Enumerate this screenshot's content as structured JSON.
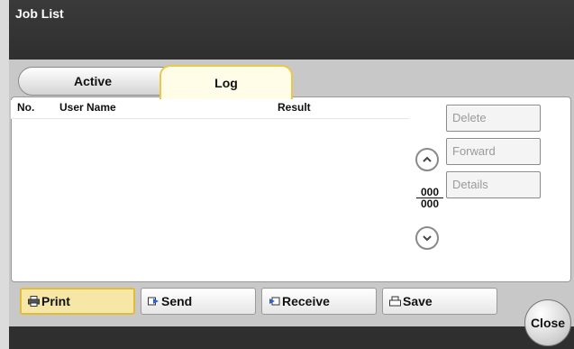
{
  "window": {
    "title": "Job List"
  },
  "tabs": [
    {
      "label": "Active",
      "selected": false
    },
    {
      "label": "Log",
      "selected": true
    }
  ],
  "list": {
    "columns": [
      "No.",
      "User Name",
      "Result"
    ],
    "rows": []
  },
  "side_buttons": [
    {
      "label": "Delete",
      "enabled": false
    },
    {
      "label": "Forward",
      "enabled": false
    },
    {
      "label": "Details",
      "enabled": false
    }
  ],
  "pager": {
    "current": "000",
    "total": "000"
  },
  "bottom_buttons": [
    {
      "label": "Print",
      "icon": "print-icon",
      "selected": true
    },
    {
      "label": "Send",
      "icon": "send-icon",
      "selected": false
    },
    {
      "label": "Receive",
      "icon": "receive-icon",
      "selected": false
    },
    {
      "label": "Save",
      "icon": "save-icon",
      "selected": false
    }
  ],
  "close": {
    "label": "Close"
  },
  "colors": {
    "accent": "#e1bc3a",
    "selected_fill": "#f6e7a6",
    "title_bg": "#2f2f2f"
  }
}
